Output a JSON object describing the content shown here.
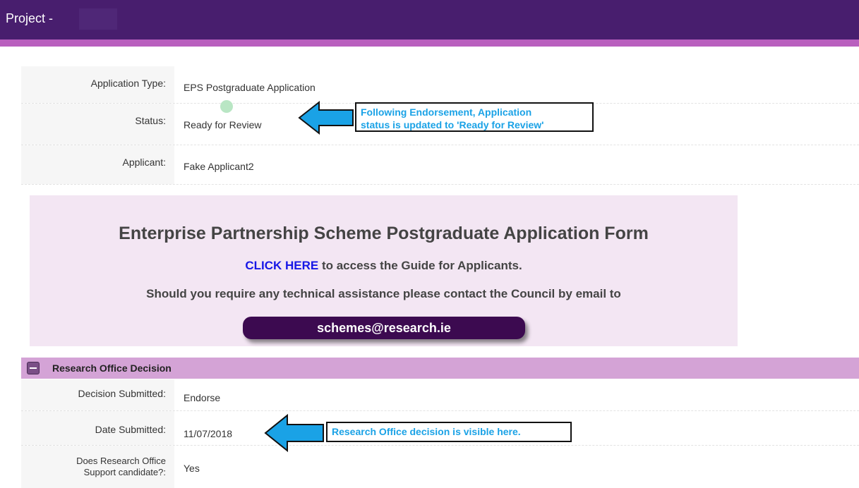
{
  "header": {
    "title": "Project -"
  },
  "details": [
    {
      "label": "Application Type:",
      "value": "EPS Postgraduate Application"
    },
    {
      "label": "Status:",
      "value": "Ready for Review"
    },
    {
      "label": "Applicant:",
      "value": "Fake Applicant2"
    }
  ],
  "callout_status": {
    "line1": "Following Endorsement, Application",
    "line2": "status is updated to 'Ready for Review'"
  },
  "banner": {
    "heading": "Enterprise Partnership Scheme Postgraduate Application Form",
    "click_here": "CLICK HERE",
    "guide_text": " to access the Guide for Applicants.",
    "assistance_text": "Should you require any technical assistance please contact the Council by email to",
    "email": "schemes@research.ie"
  },
  "section": {
    "title": "Research Office Decision",
    "rows": [
      {
        "label": "Decision Submitted:",
        "value": "Endorse"
      },
      {
        "label": "Date Submitted:",
        "value": "11/07/2018"
      },
      {
        "label_line1": "Does Research Office",
        "label_line2": "Support candidate?:",
        "value": "Yes"
      }
    ]
  },
  "callout_decision": {
    "text": "Research Office decision is visible here."
  },
  "colors": {
    "header": "#481e6e",
    "stripe": "#b95fbe",
    "section": "#d4a3d6",
    "banner": "#f3e6f3",
    "callout_text": "#1aa2e6",
    "arrow": "#1aa2e6",
    "status_dot": "#b9e6c4"
  }
}
